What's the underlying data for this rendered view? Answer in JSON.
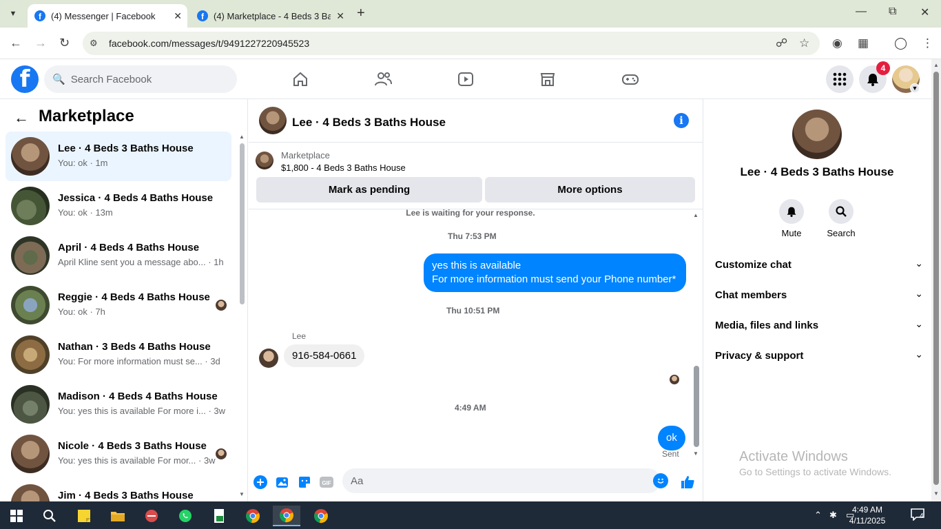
{
  "browser": {
    "tabs": [
      {
        "title": "(4) Messenger | Facebook",
        "active": true
      },
      {
        "title": "(4) Marketplace - 4 Beds 3 Bath",
        "active": false
      }
    ],
    "url": "facebook.com/messages/t/9491227220945523"
  },
  "fb": {
    "search_placeholder": "Search Facebook",
    "notification_count": "4"
  },
  "left": {
    "title": "Marketplace",
    "chats": [
      {
        "name": "Lee · 4 Beds 3 Baths House",
        "snippet": "You: ok · 1m",
        "thumb": "room",
        "selected": true
      },
      {
        "name": "Jessica · 4 Beds 4 Baths House",
        "snippet": "You: ok · 13m",
        "thumb": "house1"
      },
      {
        "name": "April · 4 Beds 4 Baths House",
        "snippet": "April Kline sent you a message abo... · 1h",
        "thumb": "house2"
      },
      {
        "name": "Reggie · 4 Beds 4 Baths House",
        "snippet": "You: ok · 7h",
        "thumb": "house3"
      },
      {
        "name": "Nathan · 3 Beds 4 Baths House",
        "snippet": "You: For more information must se... · 3d",
        "thumb": "house4"
      },
      {
        "name": "Madison · 4 Beds 4 Baths House",
        "snippet": "You: yes this is available For more i... · 3w",
        "thumb": "house5"
      },
      {
        "name": "Nicole · 4 Beds 3 Baths House",
        "snippet": "You: yes this is available For mor... · 3w",
        "thumb": "room"
      },
      {
        "name": "Jim · 4 Beds 3 Baths House",
        "snippet": "",
        "thumb": "room"
      }
    ]
  },
  "conversation": {
    "title": "Lee · 4 Beds 3 Baths House",
    "listing_category": "Marketplace",
    "listing_price": "$1,800 - 4 Beds 3 Baths House",
    "mark_pending": "Mark as pending",
    "more_options": "More options",
    "waiting_text": "Lee is waiting for your response.",
    "time1": "Thu 7:53 PM",
    "outgoing1_line1": "yes this is available",
    "outgoing1_line2": "For more information must send your Phone number*",
    "time2": "Thu 10:51 PM",
    "sender": "Lee",
    "incoming1": "916-584-0661",
    "time3": "4:49 AM",
    "outgoing2": "ok",
    "status": "Sent",
    "composer_placeholder": "Aa"
  },
  "details": {
    "name": "Lee · 4 Beds 3 Baths House",
    "mute": "Mute",
    "search": "Search",
    "sections": [
      "Customize chat",
      "Chat members",
      "Media, files and links",
      "Privacy & support"
    ],
    "activate_title": "Activate Windows",
    "activate_sub": "Go to Settings to activate Windows."
  },
  "taskbar": {
    "time": "4:49 AM",
    "date": "4/11/2025",
    "notifications": "4"
  }
}
